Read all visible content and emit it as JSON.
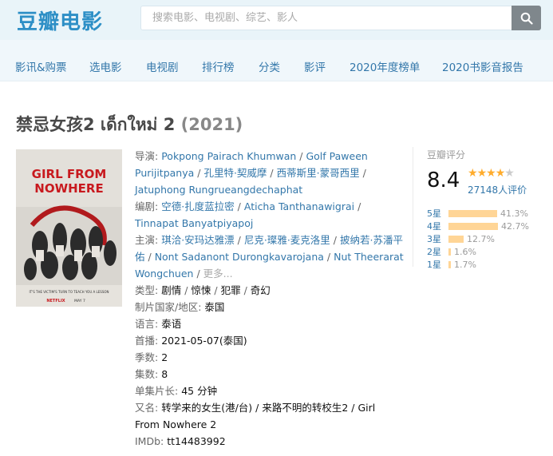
{
  "header": {
    "logo": "豆瓣电影",
    "search_placeholder": "搜索电影、电视剧、综艺、影人"
  },
  "nav": [
    "影讯&购票",
    "选电影",
    "电视剧",
    "排行榜",
    "分类",
    "影评",
    "2020年度榜单",
    "2020书影音报告"
  ],
  "title": {
    "name": "禁忌女孩2 เด็กใหม่ 2",
    "year": "(2021)"
  },
  "poster": {
    "headline_1": "GIRL FROM",
    "headline_2": "NOWHERE",
    "tagline": "IT'S THE VICTIM'S TURN TO TEACH YOU A LESSON",
    "brand": "NETFLIX",
    "date": "MAY 7"
  },
  "info": {
    "director_label": "导演",
    "directors": [
      "Pokpong Pairach Khumwan",
      "Golf Paween Purijitpanya",
      "孔里特·契威摩",
      "西蒂斯里·蒙哥西里",
      "Jatuphong Rungrueangdechaphat"
    ],
    "writer_label": "编剧",
    "writers": [
      "空德·扎度蓝拉密",
      "Aticha Tanthanawigrai",
      "Tinnapat Banyatpiyapoj"
    ],
    "cast_label": "主演",
    "cast": [
      "琪洽·安玛达雅漂",
      "尼克·璨雅·麦克洛里",
      "披纳若·苏潘平佑",
      "Nont Sadanont Durongkavarojana",
      "Nut Theerarat Wongchuen"
    ],
    "more": "更多...",
    "genre_label": "类型:",
    "genres": [
      "剧情",
      "惊悚",
      "犯罪",
      "奇幻"
    ],
    "country_label": "制片国家/地区:",
    "country": "泰国",
    "language_label": "语言:",
    "language": "泰语",
    "premiere_label": "首播:",
    "premiere": "2021-05-07(泰国)",
    "seasons_label": "季数:",
    "seasons": "2",
    "episodes_label": "集数:",
    "episodes": "8",
    "runtime_label": "单集片长:",
    "runtime": "45 分钟",
    "aka_label": "又名:",
    "aka_1": "转学来的女生(港/台) / 来路不明的转校生2 / Girl",
    "aka_2": "From Nowhere 2",
    "imdb_label": "IMDb:",
    "imdb": "tt14483992"
  },
  "rating": {
    "title": "豆瓣评分",
    "score": "8.4",
    "stars": 4,
    "count": "27148人评价",
    "distribution": [
      {
        "label": "5星",
        "pct": "41.3%",
        "value": 41.3
      },
      {
        "label": "4星",
        "pct": "42.7%",
        "value": 42.7
      },
      {
        "label": "3星",
        "pct": "12.7%",
        "value": 12.7
      },
      {
        "label": "2星",
        "pct": "1.6%",
        "value": 1.6
      },
      {
        "label": "1星",
        "pct": "1.7%",
        "value": 1.7
      }
    ]
  },
  "colors": {
    "link": "#3377aa",
    "logo": "#2d8fc6",
    "star": "#ffac2d",
    "bar": "#ffd596"
  }
}
